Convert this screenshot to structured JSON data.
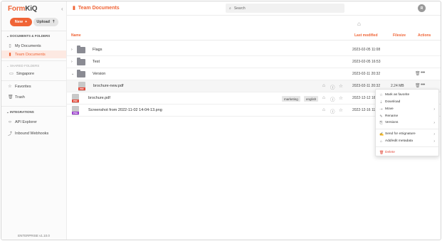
{
  "app": {
    "logo_form": "Form",
    "logo_kiq": "KiQ",
    "version": "ENTERPRISE v1.10.0"
  },
  "sidebar": {
    "new_label": "New",
    "upload_label": "Upload",
    "section_documents": "DOCUMENTS & FOLDERS",
    "my_documents": "My Documents",
    "team_documents": "Team Documents",
    "section_shared": "SHARED FOLDERS",
    "shared_singapore": "Singapore",
    "favorites": "Favorites",
    "trash": "Trash",
    "section_integrations": "INTEGRATIONS",
    "api_explorer": "API Explorer",
    "inbound_webhooks": "Inbound Webhooks"
  },
  "header": {
    "breadcrumb": "Team Documents",
    "search_placeholder": "Search",
    "avatar_initial": "R"
  },
  "table": {
    "columns": {
      "name": "Name",
      "last_modified": "Last modified",
      "filesize": "Filesize",
      "actions": "Actions"
    },
    "rows": [
      {
        "name": "Flags",
        "date": "2023-02-05 11:08",
        "size": ""
      },
      {
        "name": "Test",
        "date": "2023-02-05 16:53",
        "size": ""
      },
      {
        "name": "Version",
        "date": "2023-02-11 20:32",
        "size": ""
      },
      {
        "name": "brochure-new.pdf",
        "date": "2023-02-11 20:32",
        "size": "2.24 MB",
        "icon": "PDF"
      },
      {
        "name": "brochure.pdf",
        "date": "2022-12-12 16",
        "size": "",
        "icon": "PDF",
        "tags": [
          "marketing",
          "english"
        ]
      },
      {
        "name": "Screenshot from 2022-11-02 14-04-13.png",
        "date": "2022-12-16 11",
        "size": "",
        "icon": "PNG"
      }
    ]
  },
  "context_menu": {
    "items": [
      "Mark as favorite",
      "Download",
      "Move",
      "Rename",
      "Versions",
      "Send for eSignature",
      "Add/edit metadata",
      "Delete"
    ]
  },
  "colors": {
    "accent": "#f06436",
    "danger": "#e24a3b"
  }
}
